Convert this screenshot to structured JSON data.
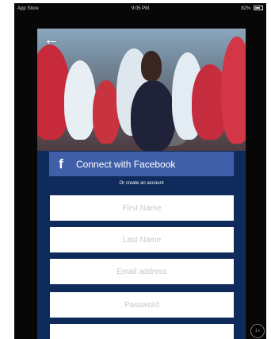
{
  "status_bar": {
    "left": "App Store",
    "time": "9:05 PM",
    "right": "82%"
  },
  "back_icon": "←",
  "facebook": {
    "icon": "f",
    "label": "Connect with Facebook",
    "color": "#3f5fa8"
  },
  "divider_text": "Or create an account",
  "form": {
    "first_name_placeholder": "First Name",
    "last_name_placeholder": "Last Name",
    "email_placeholder": "Email address",
    "password_placeholder": "Password"
  },
  "zoom_badge": "1x",
  "colors": {
    "panel_background": "#0e2b5c",
    "screen_background": "#070707"
  }
}
